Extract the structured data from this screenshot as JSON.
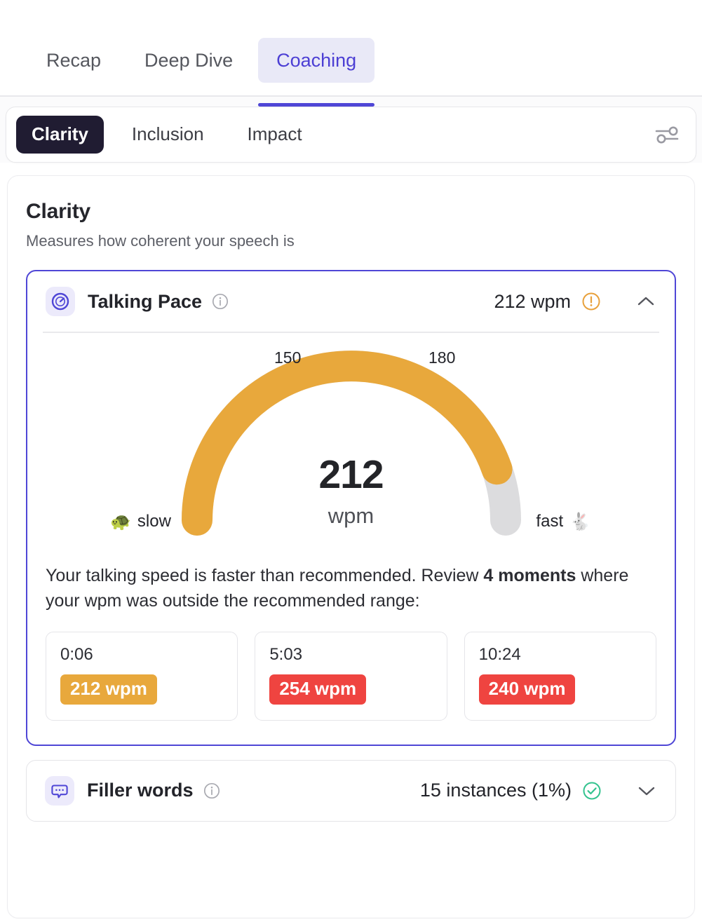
{
  "topnav": {
    "tabs": [
      {
        "label": "Recap",
        "active": false
      },
      {
        "label": "Deep Dive",
        "active": false
      },
      {
        "label": "Coaching",
        "active": true
      }
    ],
    "active_color": "#4c3fd4"
  },
  "category_bar": {
    "pills": [
      {
        "label": "Clarity",
        "selected": true
      },
      {
        "label": "Inclusion",
        "selected": false
      },
      {
        "label": "Impact",
        "selected": false
      }
    ],
    "settings_icon": "sliders-icon",
    "selected_bg": "#201c32"
  },
  "clarity": {
    "title": "Clarity",
    "subtitle": "Measures how coherent your speech is"
  },
  "talking_pace": {
    "icon": "speedometer-icon",
    "title": "Talking Pace",
    "info_icon": "info-icon",
    "value": "212 wpm",
    "status_icon": "warning-icon",
    "status_color": "#e8a13c",
    "chevron": "chevron-up-icon",
    "gauge": {
      "number": "212",
      "unit": "wpm",
      "tick_low": "150",
      "tick_high": "180",
      "slow_label": "slow",
      "slow_emoji": "🐢",
      "fast_label": "fast",
      "fast_emoji": "🐇",
      "fill_color": "#e8a83c",
      "track_color": "#dcdcde"
    },
    "description_prefix": "Your talking speed is faster than recommended. Review ",
    "description_bold": "4 moments",
    "description_suffix": " where your wpm was outside the recommended range:",
    "moments": [
      {
        "time": "0:06",
        "wpm": "212 wpm",
        "color": "#e8a83c"
      },
      {
        "time": "5:03",
        "wpm": "254 wpm",
        "color": "#ef4440"
      },
      {
        "time": "10:24",
        "wpm": "240 wpm",
        "color": "#ef4440"
      }
    ]
  },
  "filler_words": {
    "icon": "speech-bubble-icon",
    "title": "Filler words",
    "info_icon": "info-icon",
    "value": "15 instances (1%)",
    "status_icon": "check-circle-icon",
    "status_color": "#34c38f",
    "chevron": "chevron-down-icon"
  },
  "chart_data": {
    "type": "gauge",
    "title": "Talking Pace",
    "value": 212,
    "unit": "wpm",
    "range": [
      120,
      220
    ],
    "ticks": [
      150,
      180
    ],
    "recommended_range": [
      150,
      180
    ],
    "fill_fraction": 0.88,
    "endpoints": [
      "slow",
      "fast"
    ],
    "fill_color": "#e8a83c",
    "track_color": "#dcdcde",
    "moments": [
      {
        "time": "0:06",
        "wpm": 212
      },
      {
        "time": "5:03",
        "wpm": 254
      },
      {
        "time": "10:24",
        "wpm": 240
      }
    ]
  }
}
